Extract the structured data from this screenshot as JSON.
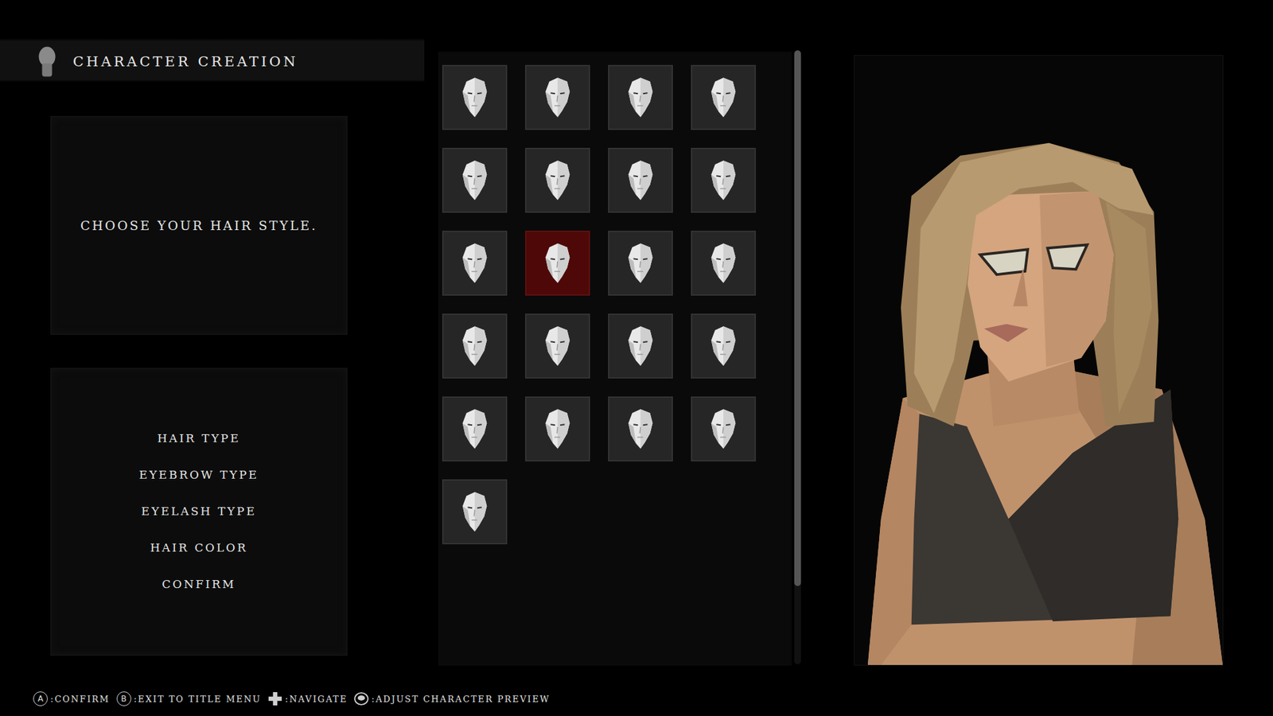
{
  "header": {
    "title": "CHARACTER CREATION"
  },
  "prompt": "CHOOSE YOUR HAIR STYLE.",
  "menu": [
    {
      "label": "HAIR TYPE"
    },
    {
      "label": "EYEBROW TYPE"
    },
    {
      "label": "EYELASH TYPE"
    },
    {
      "label": "HAIR COLOR"
    },
    {
      "label": "CONFIRM"
    }
  ],
  "hair_styles": [
    {
      "selected": false
    },
    {
      "selected": false
    },
    {
      "selected": false
    },
    {
      "selected": false
    },
    {
      "selected": false
    },
    {
      "selected": false
    },
    {
      "selected": false
    },
    {
      "selected": false
    },
    {
      "selected": false
    },
    {
      "selected": true
    },
    {
      "selected": false
    },
    {
      "selected": false
    },
    {
      "selected": false
    },
    {
      "selected": false
    },
    {
      "selected": false
    },
    {
      "selected": false
    },
    {
      "selected": false
    },
    {
      "selected": false
    },
    {
      "selected": false
    },
    {
      "selected": false
    },
    {
      "selected": false
    }
  ],
  "controls": [
    {
      "kind": "letter",
      "button": "A",
      "label": ":CONFIRM"
    },
    {
      "kind": "letter",
      "button": "B",
      "label": ":EXIT TO TITLE MENU"
    },
    {
      "kind": "dpad",
      "label": ":NAVIGATE"
    },
    {
      "kind": "stick",
      "label": ":ADJUST CHARACTER PREVIEW"
    }
  ]
}
